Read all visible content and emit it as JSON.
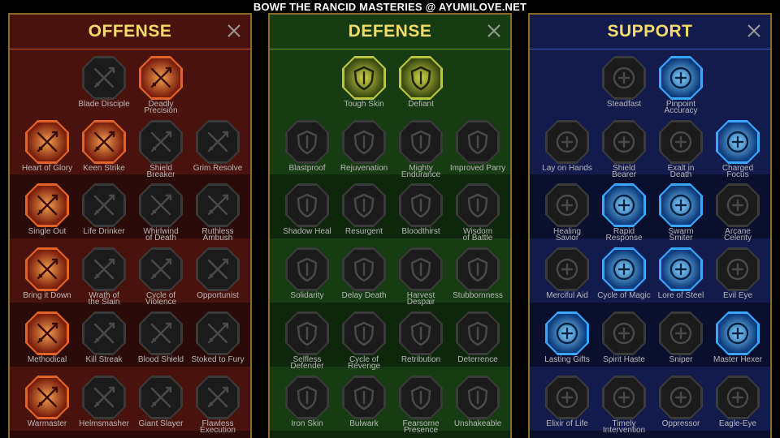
{
  "page_title": "BOWF THE RANCID MASTERIES @ AYUMILOVE.NET",
  "colors": {
    "gold_frame": "#8a6a2a",
    "title_gold": "#f3dc6a",
    "offense_bg": "#3a0f0a",
    "defense_bg": "#10300c",
    "support_bg": "#0c1238",
    "active_offense": "#e0642a",
    "active_defense": "#b8c640",
    "active_support": "#3aa6ff",
    "inactive": "#1b1b1b"
  },
  "panels": [
    {
      "key": "offense",
      "title": "OFFENSE",
      "close_icon": "close-icon",
      "rows": [
        [
          {
            "label": "Blade Disciple",
            "icon": "crossed-swords-icon",
            "active": false
          },
          {
            "label": "Deadly\nPrecision",
            "icon": "dagger-icon",
            "active": true
          }
        ],
        [
          {
            "label": "Heart of Glory",
            "icon": "horned-figure-icon",
            "active": true
          },
          {
            "label": "Keen Strike",
            "icon": "sword-slash-icon",
            "active": true
          },
          {
            "label": "Shield\nBreaker",
            "icon": "shield-arrow-icon",
            "active": false
          },
          {
            "label": "Grim Resolve",
            "icon": "heart-horns-icon",
            "active": false
          }
        ],
        [
          {
            "label": "Single Out",
            "icon": "arrows-target-icon",
            "active": true
          },
          {
            "label": "Life Drinker",
            "icon": "fangs-icon",
            "active": false
          },
          {
            "label": "Whirlwind\nof Death",
            "icon": "whirlwind-icon",
            "active": false
          },
          {
            "label": "Ruthless\nAmbush",
            "icon": "fist-dagger-icon",
            "active": false
          }
        ],
        [
          {
            "label": "Bring it Down",
            "icon": "sword-down-icon",
            "active": true
          },
          {
            "label": "Wrath of\nthe Slain",
            "icon": "hammer-icon",
            "active": false
          },
          {
            "label": "Cycle of\nViolence",
            "icon": "axes-circle-icon",
            "active": false
          },
          {
            "label": "Opportunist",
            "icon": "chains-icon",
            "active": false
          }
        ],
        [
          {
            "label": "Methodical",
            "icon": "swords-burst-icon",
            "active": true
          },
          {
            "label": "Kill Streak",
            "icon": "skull-icon",
            "active": false
          },
          {
            "label": "Blood Shield",
            "icon": "blood-shield-icon",
            "active": false
          },
          {
            "label": "Stoked to Fury",
            "icon": "raging-figure-icon",
            "active": false
          }
        ],
        [
          {
            "label": "Warmaster",
            "icon": "sword-sparkle-icon",
            "active": true
          },
          {
            "label": "Helmsmasher",
            "icon": "helmet-icon",
            "active": false
          },
          {
            "label": "Giant Slayer",
            "icon": "giant-icon",
            "active": false
          },
          {
            "label": "Flawless\nExecution",
            "icon": "skull-swords-icon",
            "active": false
          }
        ]
      ]
    },
    {
      "key": "defense",
      "title": "DEFENSE",
      "close_icon": "close-icon",
      "rows": [
        [
          {
            "label": "Tough Skin",
            "icon": "scales-icon",
            "active": true
          },
          {
            "label": "Defiant",
            "icon": "raised-fist-icon",
            "active": true
          }
        ],
        [
          {
            "label": "Blastproof",
            "icon": "chevron-shield-icon",
            "active": false
          },
          {
            "label": "Rejuvenation",
            "icon": "heart-hand-icon",
            "active": false
          },
          {
            "label": "Mighty\nEndurance",
            "icon": "muscle-figure-icon",
            "active": false
          },
          {
            "label": "Improved Parry",
            "icon": "crossed-blades-icon",
            "active": false
          }
        ],
        [
          {
            "label": "Shadow Heal",
            "icon": "shadow-figure-icon",
            "active": false
          },
          {
            "label": "Resurgent",
            "icon": "sword-shield-icon",
            "active": false
          },
          {
            "label": "Bloodthirst",
            "icon": "skull-heart-icon",
            "active": false
          },
          {
            "label": "Wisdom\nof Battle",
            "icon": "spiral-head-icon",
            "active": false
          }
        ],
        [
          {
            "label": "Solidarity",
            "icon": "group-icon",
            "active": false
          },
          {
            "label": "Delay Death",
            "icon": "hourglass-icon",
            "active": false
          },
          {
            "label": "Harvest\nDespair",
            "icon": "open-hand-icon",
            "active": false
          },
          {
            "label": "Stubbornness",
            "icon": "bull-icon",
            "active": false
          }
        ],
        [
          {
            "label": "Selfless\nDefender",
            "icon": "wall-figure-icon",
            "active": false
          },
          {
            "label": "Cycle of\nRevenge",
            "icon": "drops-icon",
            "active": false
          },
          {
            "label": "Retribution",
            "icon": "burning-skull-icon",
            "active": false
          },
          {
            "label": "Deterrence",
            "icon": "deflect-icon",
            "active": false
          }
        ],
        [
          {
            "label": "Iron Skin",
            "icon": "armored-figure-icon",
            "active": false
          },
          {
            "label": "Bulwark",
            "icon": "tower-shield-icon",
            "active": false
          },
          {
            "label": "Fearsome\nPresence",
            "icon": "demon-face-icon",
            "active": false
          },
          {
            "label": "Unshakeable",
            "icon": "strongman-icon",
            "active": false
          }
        ]
      ]
    },
    {
      "key": "support",
      "title": "SUPPORT",
      "close_icon": "close-icon",
      "rows": [
        [
          {
            "label": "Steadfast",
            "icon": "heart-sparkle-icon",
            "active": false
          },
          {
            "label": "Pinpoint\nAccuracy",
            "icon": "target-arrow-icon",
            "active": true
          }
        ],
        [
          {
            "label": "Lay on Hands",
            "icon": "praying-hands-icon",
            "active": false
          },
          {
            "label": "Shield\nBearer",
            "icon": "shield-rings-icon",
            "active": false
          },
          {
            "label": "Exalt in\nDeath",
            "icon": "flaming-skull-icon",
            "active": false
          },
          {
            "label": "Charged\nFocus",
            "icon": "lightning-hand-icon",
            "active": true
          }
        ],
        [
          {
            "label": "Healing\nSavior",
            "icon": "healer-figure-icon",
            "active": false
          },
          {
            "label": "Rapid\nResponse",
            "icon": "lightning-icon",
            "active": true
          },
          {
            "label": "Swarm\nSmiter",
            "icon": "storm-icon",
            "active": true
          },
          {
            "label": "Arcane\nCelerity",
            "icon": "twin-figures-icon",
            "active": false
          }
        ],
        [
          {
            "label": "Merciful Aid",
            "icon": "chained-heart-icon",
            "active": false
          },
          {
            "label": "Cycle of Magic",
            "icon": "comet-icon",
            "active": true
          },
          {
            "label": "Lore of Steel",
            "icon": "book-icon",
            "active": true
          },
          {
            "label": "Evil Eye",
            "icon": "evil-eye-icon",
            "active": false
          }
        ],
        [
          {
            "label": "Lasting Gifts",
            "icon": "compass-star-icon",
            "active": true
          },
          {
            "label": "Spirit Haste",
            "icon": "winged-boot-icon",
            "active": false
          },
          {
            "label": "Sniper",
            "icon": "eye-icon",
            "active": false
          },
          {
            "label": "Master Hexer",
            "icon": "hex-figure-icon",
            "active": true
          }
        ],
        [
          {
            "label": "Elixir of Life",
            "icon": "potion-icon",
            "active": false
          },
          {
            "label": "Timely\nIntervention",
            "icon": "skull-hourglass-icon",
            "active": false
          },
          {
            "label": "Oppressor",
            "icon": "crushing-fist-icon",
            "active": false
          },
          {
            "label": "Eagle-Eye",
            "icon": "eagle-icon",
            "active": false
          }
        ]
      ]
    }
  ]
}
